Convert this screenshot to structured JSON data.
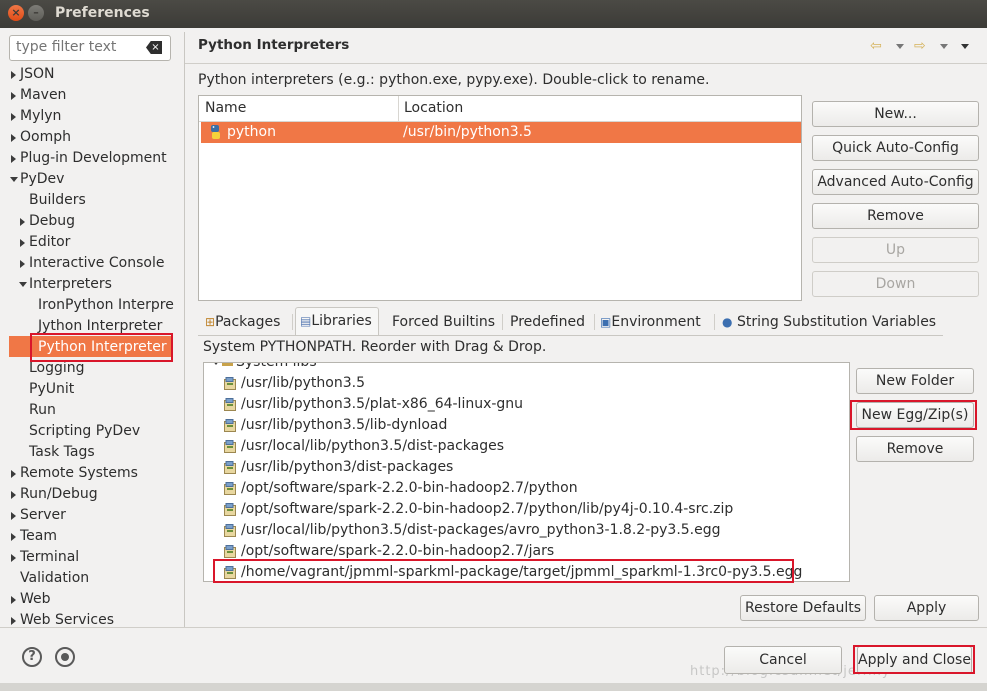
{
  "window": {
    "title": "Preferences"
  },
  "filter": {
    "placeholder": "type filter text"
  },
  "tree": [
    {
      "label": "JSON",
      "level": 0,
      "arrow": "right"
    },
    {
      "label": "Maven",
      "level": 0,
      "arrow": "right"
    },
    {
      "label": "Mylyn",
      "level": 0,
      "arrow": "right"
    },
    {
      "label": "Oomph",
      "level": 0,
      "arrow": "right"
    },
    {
      "label": "Plug-in Development",
      "level": 0,
      "arrow": "right"
    },
    {
      "label": "PyDev",
      "level": 0,
      "arrow": "down"
    },
    {
      "label": "Builders",
      "level": 1,
      "arrow": "none"
    },
    {
      "label": "Debug",
      "level": 1,
      "arrow": "right"
    },
    {
      "label": "Editor",
      "level": 1,
      "arrow": "right"
    },
    {
      "label": "Interactive Console",
      "level": 1,
      "arrow": "right"
    },
    {
      "label": "Interpreters",
      "level": 1,
      "arrow": "down"
    },
    {
      "label": "IronPython Interpre",
      "level": 2,
      "arrow": "none"
    },
    {
      "label": "Jython Interpreter",
      "level": 2,
      "arrow": "none"
    },
    {
      "label": "Python Interpreter",
      "level": 2,
      "arrow": "none",
      "selected": true
    },
    {
      "label": "Logging",
      "level": 1,
      "arrow": "none"
    },
    {
      "label": "PyUnit",
      "level": 1,
      "arrow": "none"
    },
    {
      "label": "Run",
      "level": 1,
      "arrow": "none"
    },
    {
      "label": "Scripting PyDev",
      "level": 1,
      "arrow": "none"
    },
    {
      "label": "Task Tags",
      "level": 1,
      "arrow": "none"
    },
    {
      "label": "Remote Systems",
      "level": 0,
      "arrow": "right"
    },
    {
      "label": "Run/Debug",
      "level": 0,
      "arrow": "right"
    },
    {
      "label": "Server",
      "level": 0,
      "arrow": "right"
    },
    {
      "label": "Team",
      "level": 0,
      "arrow": "right"
    },
    {
      "label": "Terminal",
      "level": 0,
      "arrow": "right"
    },
    {
      "label": "Validation",
      "level": 0,
      "arrow": "none"
    },
    {
      "label": "Web",
      "level": 0,
      "arrow": "right"
    },
    {
      "label": "Web Services",
      "level": 0,
      "arrow": "right"
    }
  ],
  "page": {
    "title": "Python Interpreters",
    "description": "Python interpreters (e.g.: python.exe, pypy.exe).   Double-click to rename."
  },
  "interpreters": {
    "columns": [
      "Name",
      "Location"
    ],
    "rows": [
      {
        "name": "python",
        "location": "/usr/bin/python3.5"
      }
    ]
  },
  "side_buttons": [
    "New...",
    "Quick Auto-Config",
    "Advanced Auto-Config",
    "Remove",
    "Up",
    "Down"
  ],
  "tabs": [
    {
      "label": "Packages",
      "icon": "packages-icon"
    },
    {
      "label": "Libraries",
      "icon": "libraries-icon",
      "active": true
    },
    {
      "label": "Forced Builtins",
      "icon": ""
    },
    {
      "label": "Predefined",
      "icon": ""
    },
    {
      "label": "Environment",
      "icon": "environment-icon"
    },
    {
      "label": "String Substitution Variables",
      "icon": "variable-icon"
    }
  ],
  "libraries": {
    "description": "System PYTHONPATH.   Reorder with Drag & Drop.",
    "group_label": "System libs",
    "paths": [
      "/usr/lib/python3.5",
      "/usr/lib/python3.5/plat-x86_64-linux-gnu",
      "/usr/lib/python3.5/lib-dynload",
      "/usr/local/lib/python3.5/dist-packages",
      "/usr/lib/python3/dist-packages",
      "/opt/software/spark-2.2.0-bin-hadoop2.7/python",
      "/opt/software/spark-2.2.0-bin-hadoop2.7/python/lib/py4j-0.10.4-src.zip",
      "/usr/local/lib/python3.5/dist-packages/avro_python3-1.8.2-py3.5.egg",
      "/opt/software/spark-2.2.0-bin-hadoop2.7/jars",
      "/home/vagrant/jpmml-sparkml-package/target/jpmml_sparkml-1.3rc0-py3.5.egg"
    ],
    "buttons": [
      "New Folder",
      "New Egg/Zip(s)",
      "Remove"
    ]
  },
  "page_buttons": {
    "restore": "Restore Defaults",
    "apply": "Apply"
  },
  "dialog_buttons": {
    "cancel": "Cancel",
    "apply_close": "Apply and Close"
  },
  "watermark": "http://blog.csdn.net/jeffiny",
  "colors": {
    "selection": "#f07746",
    "highlight": "#d9162a",
    "titlebar": "#3c3b37"
  }
}
